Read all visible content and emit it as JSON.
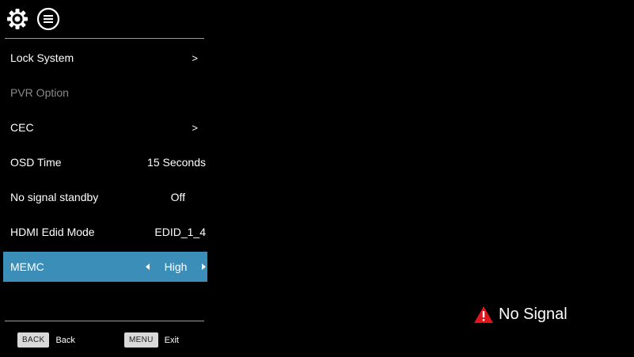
{
  "top_icons": [
    "settings-gear-icon",
    "menu-list-icon"
  ],
  "menu": {
    "items": [
      {
        "label": "Lock System",
        "arrow": ">",
        "enabled": true
      },
      {
        "label": "PVR Option",
        "enabled": false
      },
      {
        "label": "CEC",
        "arrow": ">",
        "enabled": true
      },
      {
        "label": "OSD Time",
        "value": "15 Seconds",
        "enabled": true
      },
      {
        "label": "No signal standby",
        "value": "Off",
        "enabled": true
      },
      {
        "label": "HDMI Edid Mode",
        "value": "EDID_1_4",
        "enabled": true
      },
      {
        "label": "MEMC",
        "value": "High",
        "enabled": true,
        "selected": true
      }
    ]
  },
  "footer": {
    "back_key": "BACK",
    "back_label": "Back",
    "menu_key": "MENU",
    "menu_label": "Exit"
  },
  "status": {
    "no_signal": "No Signal",
    "warning_color": "#e0151b"
  },
  "colors": {
    "selected_row": "#3b8eb8",
    "disabled_text": "#8a8a8a",
    "background": "#000000"
  }
}
